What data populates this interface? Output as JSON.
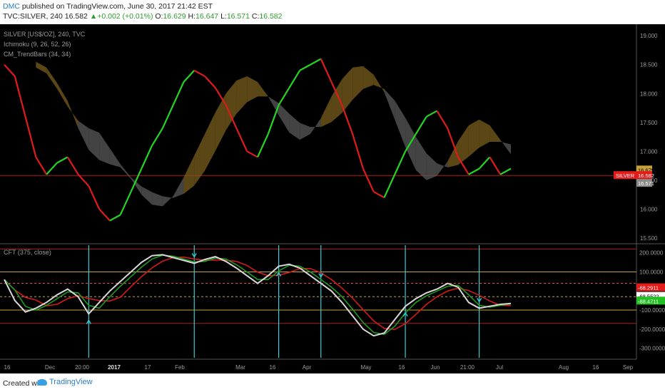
{
  "header": {
    "author": "DMC",
    "published": "published on TradingView.com, June 30, 2017 21:42 EST",
    "symbol": "TVC:SILVER, 240",
    "last": "16.582",
    "change": "+0.002 (+0.01%)",
    "o_label": "O:",
    "o": "16.629",
    "h_label": "H:",
    "h": "16.647",
    "l_label": "L:",
    "l": "16.571",
    "c_label": "C:",
    "c": "16.582"
  },
  "main_pane": {
    "legend": [
      "SILVER [US$/OZ], 240, TVC",
      "Ichimoku (9, 26, 52, 26)",
      "CM_TrendBars (34, 34)"
    ],
    "y_ticks": [
      "19.000",
      "18.500",
      "18.000",
      "17.500",
      "17.000",
      "16.500",
      "16.000",
      "15.500"
    ],
    "tags": [
      {
        "label": "16.679",
        "color": "#c9a13a"
      },
      {
        "label": "SILVER",
        "color": "#e31b1b"
      },
      {
        "label": "16.582",
        "color": "#e31b1b"
      },
      {
        "label": "16.571",
        "color": "#8a8a8a"
      }
    ]
  },
  "cft_pane": {
    "legend": "CFT (375, close)",
    "y_ticks": [
      "200.0000",
      "100.0000",
      "-100.0000",
      "-200.0000",
      "-300.0000"
    ],
    "tags": [
      {
        "label": "-68.2911",
        "color": "#e31b1b"
      },
      {
        "label": "-68.5522",
        "color": "#ffffff"
      },
      {
        "label": "-88.4711",
        "color": "#22c122"
      }
    ]
  },
  "x_axis": {
    "labels": [
      "16",
      "Dec",
      "20:00",
      "2017",
      "17",
      "Feb",
      "Mar",
      "16",
      "Apr",
      "May",
      "16",
      "Jun",
      "21:00",
      "Jul",
      "Aug",
      "16",
      "Sep"
    ]
  },
  "footer": {
    "created": "Created with",
    "brand": "TradingView"
  },
  "chart_data": {
    "type": "line",
    "main": {
      "series": [
        {
          "values": [
            18.5,
            18.3,
            17.6,
            16.9,
            16.6,
            16.8,
            16.9,
            16.6,
            16.4,
            16.0,
            15.8,
            15.9,
            16.3,
            16.7,
            17.1,
            17.4,
            17.8,
            18.2,
            18.4,
            18.3,
            18.1,
            17.8,
            17.4,
            17.0,
            16.9,
            17.3,
            17.8,
            18.1,
            18.4,
            18.5,
            18.6,
            18.2,
            17.8,
            17.3,
            16.7,
            16.3,
            16.2,
            16.6,
            17.0,
            17.3,
            17.6,
            17.7,
            17.4,
            16.9,
            16.6,
            16.7,
            16.9,
            16.6,
            16.7
          ]
        }
      ],
      "last_value": 16.582,
      "ylim": [
        15.4,
        19.2
      ]
    },
    "cft": {
      "series": [
        {
          "values": [
            60,
            -50,
            -110,
            -90,
            -60,
            -20,
            10,
            -30,
            -120,
            -60,
            0,
            50,
            100,
            150,
            185,
            190,
            175,
            160,
            145,
            165,
            180,
            155,
            120,
            80,
            40,
            80,
            130,
            140,
            120,
            80,
            40,
            0,
            -60,
            -130,
            -200,
            -235,
            -220,
            -150,
            -80,
            -40,
            -10,
            10,
            40,
            20,
            -60,
            -90,
            -80,
            -70,
            -65
          ]
        }
      ],
      "ylim": [
        -350,
        240
      ]
    },
    "signal_categories": [
      8,
      18,
      26,
      30,
      38,
      45
    ]
  }
}
